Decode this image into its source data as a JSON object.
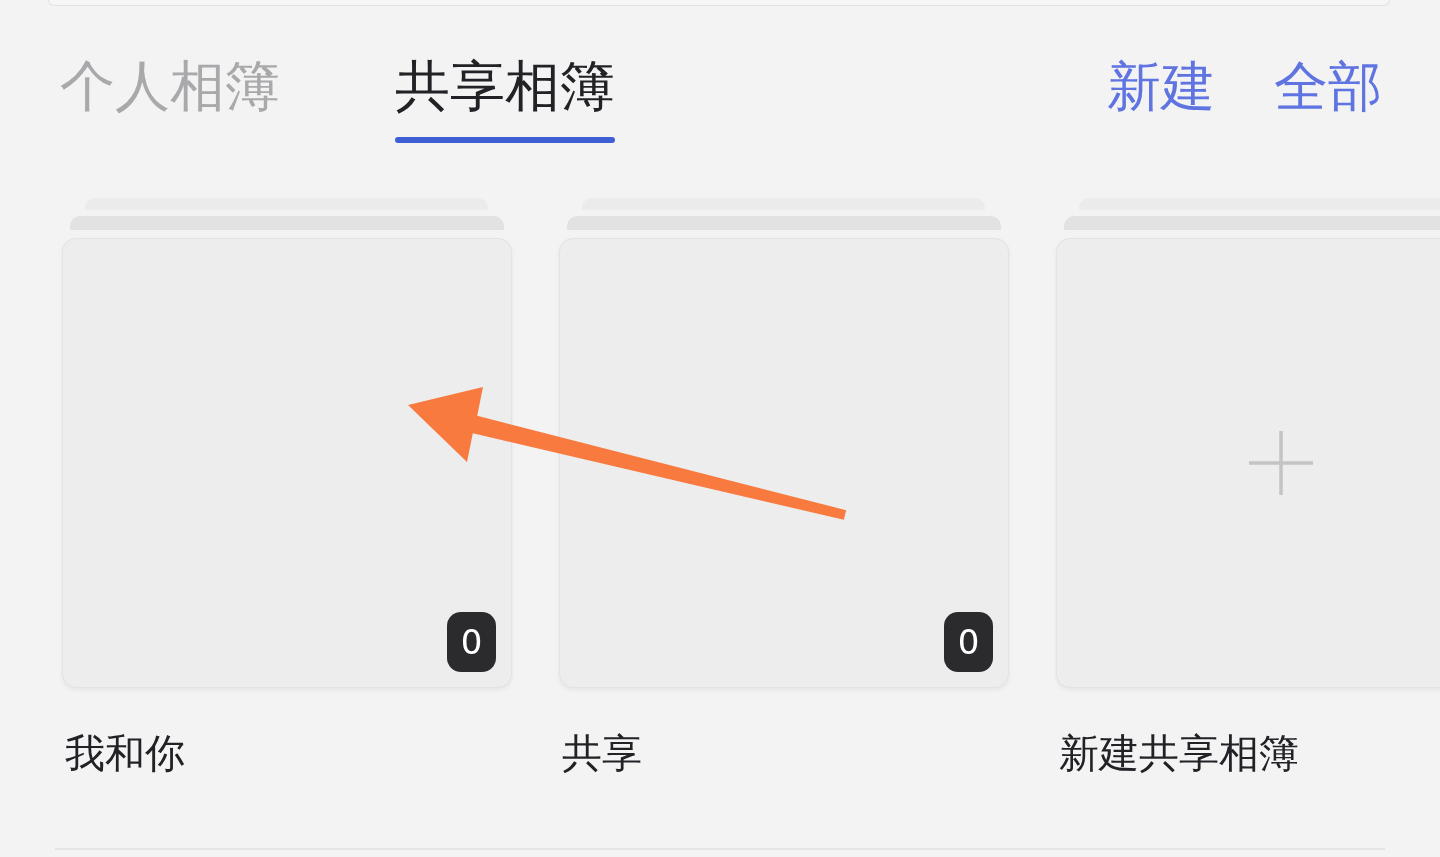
{
  "tabs": [
    {
      "label": "个人相簿",
      "selected": false
    },
    {
      "label": "共享相簿",
      "selected": true
    }
  ],
  "actions": [
    "新建",
    "全部"
  ],
  "albums": [
    {
      "kind": "album",
      "name": "我和你",
      "count": "0"
    },
    {
      "kind": "album",
      "name": "共享",
      "count": "0"
    },
    {
      "kind": "create",
      "name": "新建共享相簿"
    }
  ]
}
